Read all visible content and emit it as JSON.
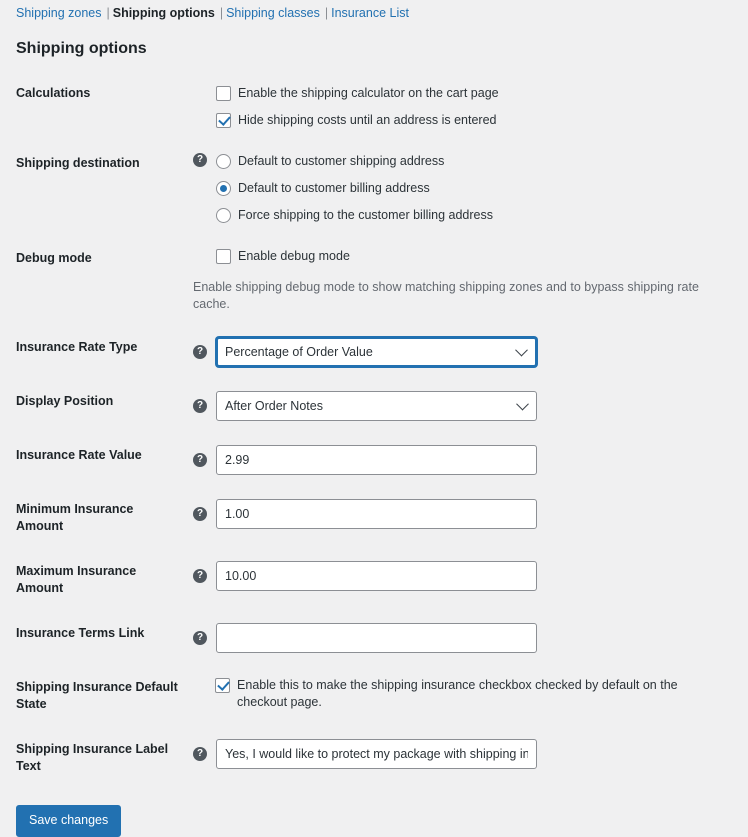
{
  "subnav": {
    "items": [
      {
        "label": "Shipping zones",
        "current": false
      },
      {
        "label": "Shipping options",
        "current": true
      },
      {
        "label": "Shipping classes",
        "current": false
      },
      {
        "label": "Insurance List",
        "current": false
      }
    ],
    "separator": "|"
  },
  "page": {
    "title": "Shipping options"
  },
  "help_glyph": "?",
  "rows": {
    "calculations": {
      "label": "Calculations",
      "options": [
        {
          "label": "Enable the shipping calculator on the cart page",
          "checked": false
        },
        {
          "label": "Hide shipping costs until an address is entered",
          "checked": true
        }
      ]
    },
    "shipping_destination": {
      "label": "Shipping destination",
      "options": [
        {
          "label": "Default to customer shipping address",
          "selected": false
        },
        {
          "label": "Default to customer billing address",
          "selected": true
        },
        {
          "label": "Force shipping to the customer billing address",
          "selected": false
        }
      ]
    },
    "debug_mode": {
      "label": "Debug mode",
      "checkbox_label": "Enable debug mode",
      "checked": false,
      "description": "Enable shipping debug mode to show matching shipping zones and to bypass shipping rate cache."
    },
    "insurance_rate_type": {
      "label": "Insurance Rate Type",
      "value": "Percentage of Order Value",
      "focused": true
    },
    "display_position": {
      "label": "Display Position",
      "value": "After Order Notes",
      "focused": false
    },
    "insurance_rate_value": {
      "label": "Insurance Rate Value",
      "value": "2.99"
    },
    "minimum_insurance_amount": {
      "label": "Minimum Insurance Amount",
      "value": "1.00"
    },
    "maximum_insurance_amount": {
      "label": "Maximum Insurance Amount",
      "value": "10.00"
    },
    "insurance_terms_link": {
      "label": "Insurance Terms Link",
      "value": ""
    },
    "default_state": {
      "label": "Shipping Insurance Default State",
      "checkbox_label": "Enable this to make the shipping insurance checkbox checked by default on the checkout page.",
      "checked": true
    },
    "label_text": {
      "label": "Shipping Insurance Label Text",
      "value": "Yes, I would like to protect my package with shipping insurance"
    }
  },
  "submit": {
    "save_label": "Save changes"
  }
}
